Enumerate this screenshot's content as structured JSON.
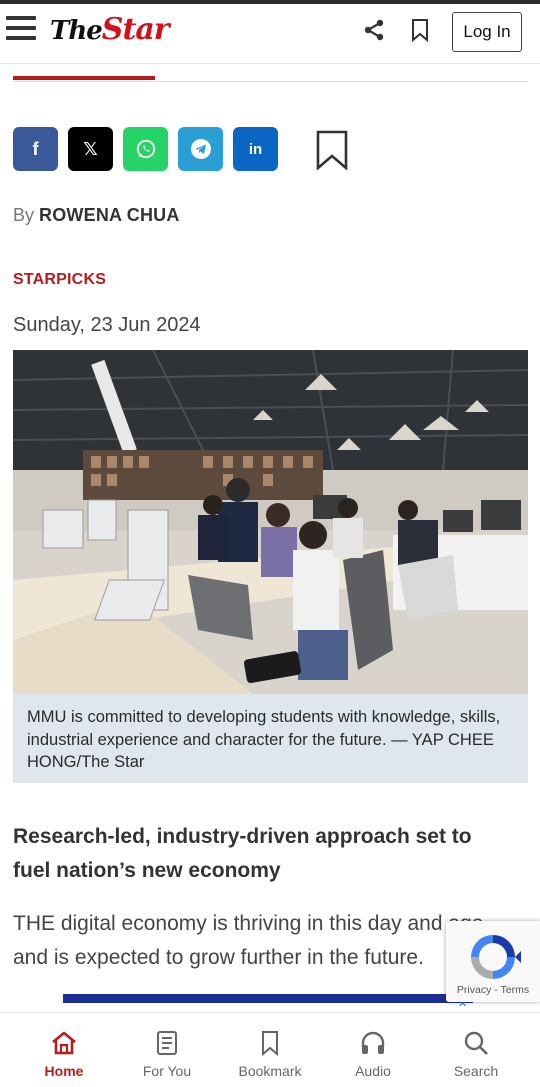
{
  "header": {
    "logo_the": "The",
    "logo_star": "Star",
    "login_label": "Log In"
  },
  "share": {
    "facebook": "f",
    "x": "𝕏",
    "linkedin": "in"
  },
  "article": {
    "by_prefix": "By",
    "author": "ROWENA CHUA",
    "section": "STARPICKS",
    "date": "Sunday, 23 Jun 2024",
    "caption": "MMU is committed to developing students with knowledge, skills, industrial experience and character for the future. — YAP CHEE HONG/The Star",
    "subheading": "Research-led, industry-driven approach set to fuel nation’s new economy",
    "body": "THE digital economy is thriving in this day and age and is expected to grow further in the future."
  },
  "recaptcha": {
    "links": "Privacy - Terms"
  },
  "bottom_nav": {
    "items": [
      {
        "label": "Home",
        "icon": "home-icon",
        "active": true
      },
      {
        "label": "For You",
        "icon": "for-you-icon"
      },
      {
        "label": "Bookmark",
        "icon": "bookmark-icon"
      },
      {
        "label": "Audio",
        "icon": "headphones-icon"
      },
      {
        "label": "Search",
        "icon": "search-icon"
      }
    ]
  },
  "colors": {
    "brand_red": "#b71c1c",
    "caption_bg": "#dfe6ee",
    "facebook": "#3b5998",
    "whatsapp": "#25d366",
    "telegram": "#2a9fd6",
    "linkedin": "#0a66c2"
  }
}
